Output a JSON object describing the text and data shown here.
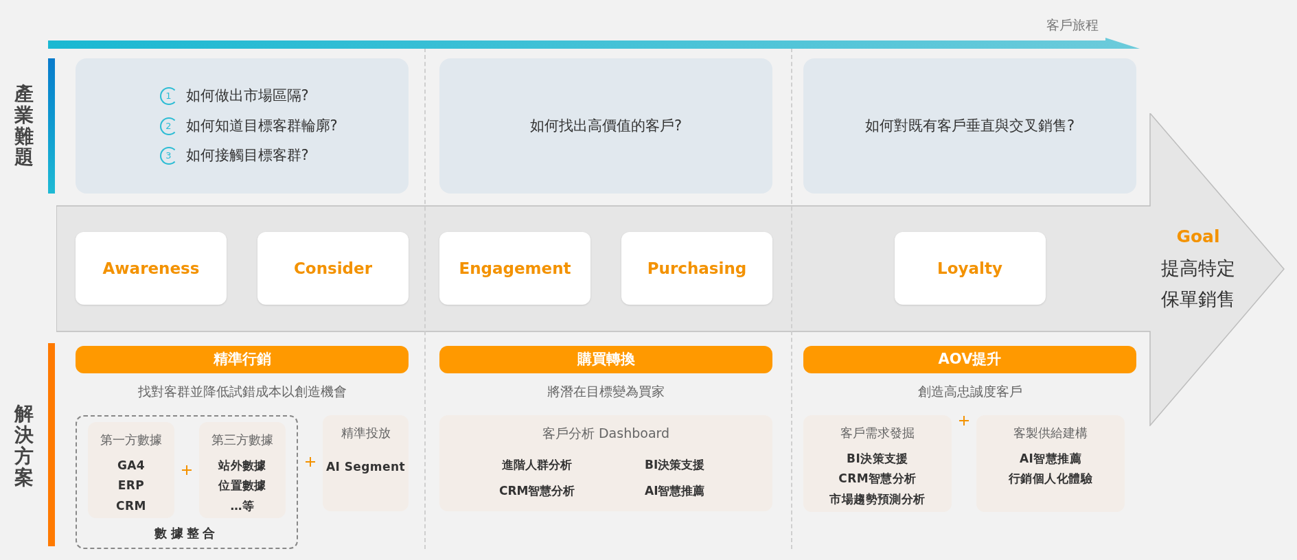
{
  "journey_label": "客戶旅程",
  "challenges": {
    "label": "產業難題",
    "columns": [
      {
        "kind": "numbered",
        "questions": [
          {
            "number": "1",
            "text": "如何做出市場區隔?"
          },
          {
            "number": "2",
            "text": "如何知道目標客群輪廓?"
          },
          {
            "number": "3",
            "text": "如何接觸目標客群?"
          }
        ]
      },
      {
        "kind": "plain",
        "questions": [
          {
            "text": "如何找出高價值的客戶?"
          }
        ]
      },
      {
        "kind": "plain",
        "questions": [
          {
            "text": "如何對既有客戶垂直與交叉銷售?"
          }
        ]
      }
    ]
  },
  "stage_columns": [
    {
      "stages": [
        "Awareness",
        "Consider"
      ]
    },
    {
      "stages": [
        "Engagement",
        "Purchasing"
      ]
    },
    {
      "stages": [
        "Loyalty"
      ]
    }
  ],
  "goal": {
    "label": "Goal",
    "lines": [
      "提高特定",
      "保單銷售"
    ]
  },
  "solutions": {
    "label": "解決方案",
    "columns": [
      {
        "title": "精準行銷",
        "subtitle": "找對客群並降低試錯成本以創造機會",
        "group": {
          "label": "數據整合",
          "cards": [
            {
              "kind": "list",
              "title": "第一方數據",
              "items": [
                "GA4",
                "ERP",
                "CRM"
              ]
            },
            {
              "kind": "list",
              "title": "第三方數據",
              "items": [
                "站外數據",
                "位置數據",
                "…等"
              ]
            }
          ]
        },
        "cards": [
          {
            "kind": "list",
            "title": "精準投放",
            "items": [
              "AI Segment"
            ]
          }
        ]
      },
      {
        "title": "購買轉換",
        "subtitle": "將潛在目標變為買家",
        "cards": [
          {
            "kind": "grid",
            "title": "客戶分析 Dashboard",
            "items": [
              "進階人群分析",
              "BI決策支援",
              "CRM智慧分析",
              "AI智慧推薦"
            ]
          }
        ]
      },
      {
        "title": "AOV提升",
        "subtitle": "創造高忠誠度客戶",
        "cards": [
          {
            "kind": "list",
            "title": "客戶需求發掘",
            "items": [
              "BI決策支援",
              "CRM智慧分析",
              "市場趨勢預測分析"
            ]
          },
          {
            "kind": "list",
            "title": "客製供給建構",
            "items": [
              "AI智慧推薦",
              "行銷個人化體驗"
            ]
          }
        ]
      }
    ]
  }
}
